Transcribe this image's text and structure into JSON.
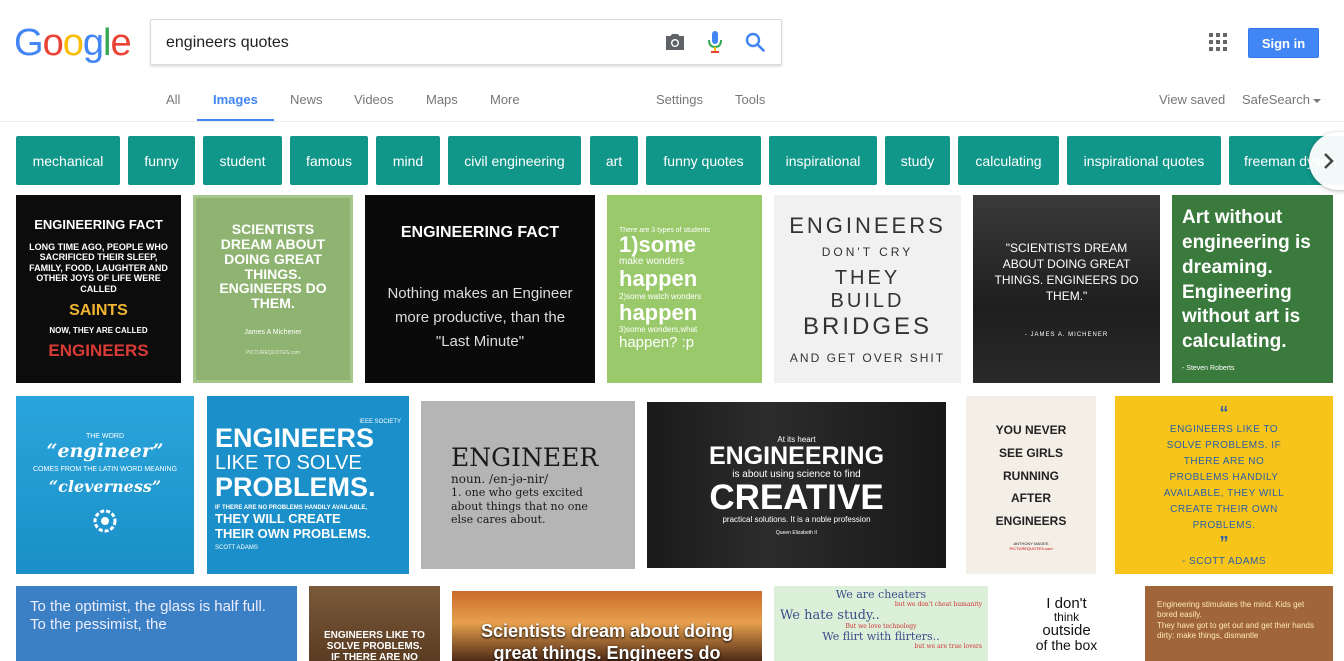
{
  "logo": {
    "letters": [
      "G",
      "o",
      "o",
      "g",
      "l",
      "e"
    ],
    "colors": [
      "#4285f4",
      "#ea4335",
      "#fbbc05",
      "#4285f4",
      "#34a853",
      "#ea4335"
    ]
  },
  "search": {
    "value": "engineers quotes"
  },
  "header": {
    "sign_in": "Sign in"
  },
  "tabs": {
    "all": "All",
    "images": "Images",
    "news": "News",
    "videos": "Videos",
    "maps": "Maps",
    "more": "More",
    "settings": "Settings",
    "tools": "Tools",
    "view_saved": "View saved",
    "safesearch": "SafeSearch"
  },
  "chips": [
    "mechanical",
    "funny",
    "student",
    "famous",
    "mind",
    "civil engineering",
    "art",
    "funny quotes",
    "inspirational",
    "study",
    "calculating",
    "inspirational quotes",
    "freeman dyson"
  ],
  "images": {
    "r1_1": {
      "title": "ENGINEERING FACT",
      "body": "LONG TIME AGO, PEOPLE WHO SACRIFICED THEIR SLEEP, FAMILY, FOOD, LAUGHTER AND OTHER JOYS OF LIFE WERE CALLED",
      "saints": "SAINTS",
      "now": "NOW, THEY ARE CALLED",
      "engineers": "ENGINEERS"
    },
    "r1_2": {
      "body": "SCIENTISTS DREAM ABOUT DOING GREAT THINGS. ENGINEERS DO THEM.",
      "author": "James A Michener",
      "site": "PICTUREQUOTES.com"
    },
    "r1_3": {
      "title": "ENGINEERING FACT",
      "body": "Nothing makes an Engineer more productive, than the \"Last Minute\""
    },
    "r1_4": {
      "l1": "There are 3 types of students",
      "l2": "1)some",
      "l3": "make wonders",
      "l4": "happen",
      "l5": "2)some watch wonders",
      "l6": "happen",
      "l7": "3)some wonders,what",
      "l8": "happen? :p"
    },
    "r1_5": {
      "l1": "ENGINEERS",
      "l2": "DON'T CRY",
      "l3": "THEY",
      "l4": "BUILD",
      "l5": "BRIDGES",
      "l6": "AND GET OVER SHIT"
    },
    "r1_6": {
      "body": "\"SCIENTISTS DREAM ABOUT DOING GREAT THINGS. ENGINEERS DO THEM.\"",
      "author": "- JAMES A. MICHENER"
    },
    "r1_7": {
      "body": "Art without engineering is dreaming. Engineering without art is calculating.",
      "author": "- Steven Roberts"
    },
    "r2_1": {
      "l1": "THE WORD",
      "l2": "“engineer”",
      "l3": "COMES FROM THE LATIN WORD MEANING",
      "l4": "“cleverness”"
    },
    "r2_2": {
      "l1": "ENGINEERS",
      "l2": "LIKE TO SOLVE",
      "l3": "PROBLEMS.",
      "l4": "IF THERE ARE NO PROBLEMS HANDILY AVAILABLE,",
      "l5": "THEY WILL CREATE",
      "l6": "THEIR OWN PROBLEMS.",
      "author": "SCOTT ADAMS",
      "badge": "IEEE SOCIETY"
    },
    "r2_3": {
      "word": "ENGINEER",
      "pron": "noun. /en-jə-nir/",
      "def": "1. one who gets excited about things that no one else cares about."
    },
    "r2_4": {
      "l1": "At its heart",
      "l2": "ENGINEERING",
      "l3": "is about using science to find",
      "l4": "CREATIVE",
      "l5": "practical solutions. It is a noble profession",
      "l6": "Queen Elizabeth II"
    },
    "r2_5": {
      "body": "YOU NEVER SEE GIRLS RUNNING AFTER ENGINEERS",
      "author": "ANTHONY MAGEE",
      "site": "PICTUREQUOTES.com"
    },
    "r2_6": {
      "body": "ENGINEERS LIKE TO SOLVE PROBLEMS. IF THERE ARE NO PROBLEMS HANDILY AVAILABLE, THEY WILL CREATE THEIR OWN PROBLEMS.",
      "author": "- SCOTT ADAMS"
    },
    "r3_1": {
      "body": "To the optimist, the glass is half full. To the pessimist, the"
    },
    "r3_2": {
      "body": "ENGINEERS LIKE TO SOLVE PROBLEMS. IF THERE ARE NO"
    },
    "r3_3": {
      "body": "Scientists dream about doing great things. Engineers do"
    },
    "r3_4": {
      "l1": "We are cheaters",
      "l2": "but we don't cheat humanity",
      "l3": "We hate study..",
      "l4": "But we love technology",
      "l5": "We flirt with flirters..",
      "l6": "but we are true lovers"
    },
    "r3_5": {
      "l1": "I don't",
      "l2": "think",
      "l3": "outside",
      "l4": "of the box"
    },
    "r3_6": {
      "l1": "Engineering stimulates the mind. Kids get bored easily.",
      "l2": "They have got to get out and get their hands dirty: make things, dismantle"
    }
  }
}
